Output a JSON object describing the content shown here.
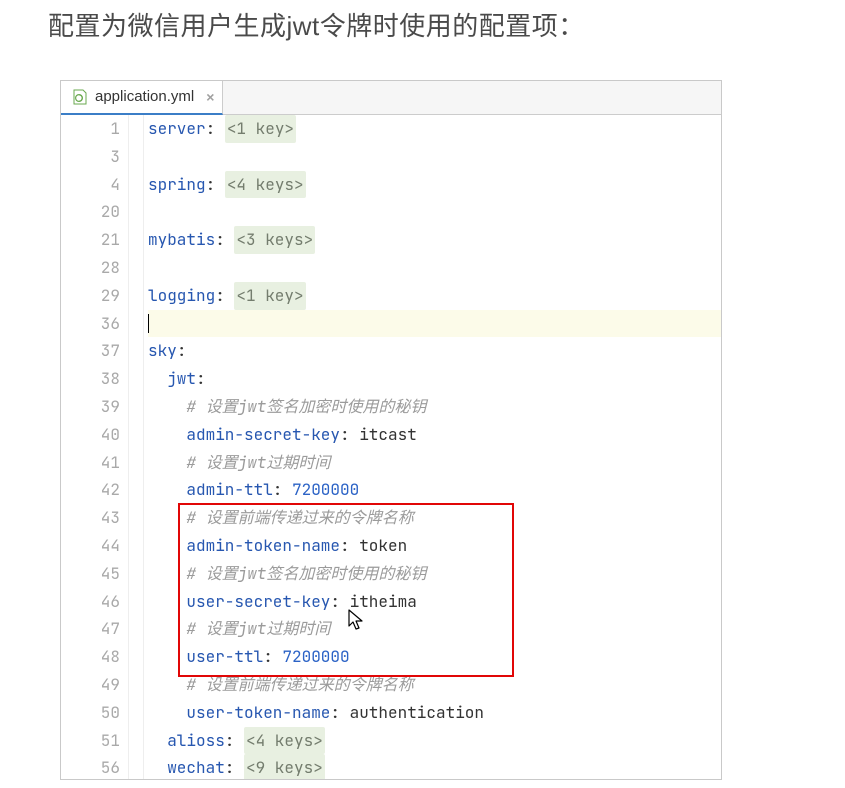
{
  "heading": "配置为微信用户生成jwt令牌时使用的配置项：",
  "tab": {
    "filename": "application.yml",
    "close_glyph": "×"
  },
  "line_numbers": [
    "1",
    "3",
    "4",
    "20",
    "21",
    "28",
    "29",
    "36",
    "37",
    "38",
    "39",
    "40",
    "41",
    "42",
    "43",
    "44",
    "45",
    "46",
    "47",
    "48",
    "49",
    "50",
    "51",
    "56"
  ],
  "folded": {
    "server": "<1 key>",
    "spring": "<4 keys>",
    "mybatis": "<3 keys>",
    "logging": "<1 key>",
    "alioss": "<4 keys>",
    "wechat": "<9 keys>"
  },
  "keys": {
    "server": "server",
    "spring": "spring",
    "mybatis": "mybatis",
    "logging": "logging",
    "sky": "sky",
    "jwt": "jwt",
    "admin_secret_key": "admin-secret-key",
    "admin_ttl": "admin-ttl",
    "admin_token_name": "admin-token-name",
    "user_secret_key": "user-secret-key",
    "user_ttl": "user-ttl",
    "user_token_name": "user-token-name",
    "alioss": "alioss",
    "wechat": "wechat"
  },
  "values": {
    "admin_secret_key": "itcast",
    "admin_ttl": "7200000",
    "admin_token_name": "token",
    "user_secret_key": "itheima",
    "user_ttl": "7200000",
    "user_token_name": "authentication"
  },
  "comments": {
    "c1": "# 设置jwt签名加密时使用的秘钥",
    "c2": "# 设置jwt过期时间",
    "c3": "# 设置前端传递过来的令牌名称",
    "c4": "# 设置jwt签名加密时使用的秘钥",
    "c5": "# 设置jwt过期时间",
    "c6": "# 设置前端传递过来的令牌名称"
  }
}
